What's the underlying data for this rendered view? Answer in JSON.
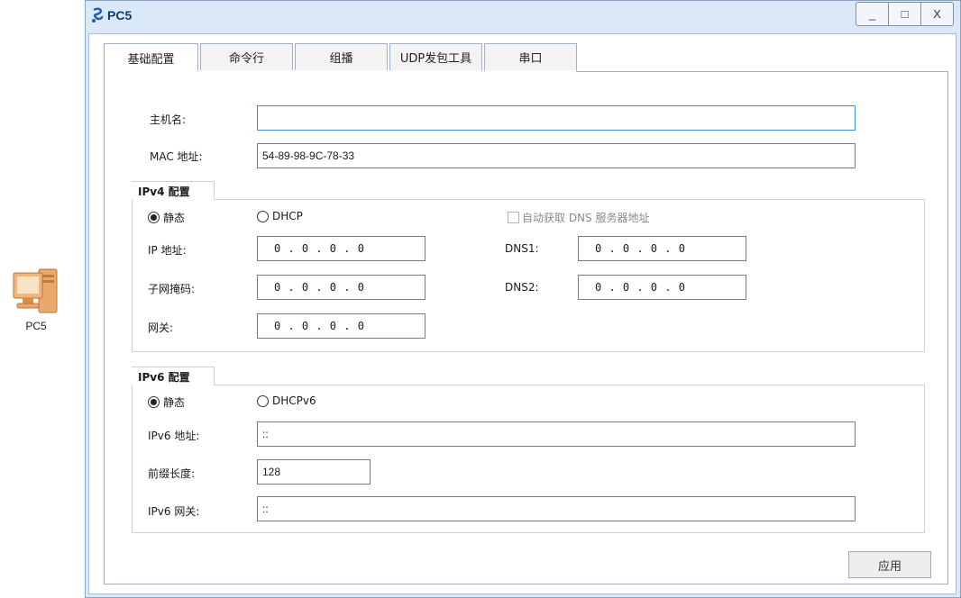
{
  "desktop": {
    "icon_label": "PC5",
    "icon_name": "pc-icon"
  },
  "window": {
    "title": "PC5",
    "title_icon": "ensp-logo-icon",
    "controls": {
      "minimize": "_",
      "maximize": "□",
      "close": "X"
    }
  },
  "tabs": [
    {
      "label": "基础配置",
      "active": true
    },
    {
      "label": "命令行",
      "active": false
    },
    {
      "label": "组播",
      "active": false
    },
    {
      "label": "UDP发包工具",
      "active": false
    },
    {
      "label": "串口",
      "active": false
    }
  ],
  "basic": {
    "hostname_label": "主机名:",
    "hostname_value": "",
    "mac_label": "MAC 地址:",
    "mac_value": "54-89-98-9C-78-33"
  },
  "ipv4": {
    "group_title": "IPv4 配置",
    "mode_static": "静态",
    "mode_dhcp": "DHCP",
    "auto_dns": "自动获取 DNS 服务器地址",
    "ip_label": "IP 地址:",
    "ip_value": "0  .  0  .  0  .  0",
    "mask_label": "子网掩码:",
    "mask_value": "0  .  0  .  0  .  0",
    "gw_label": "网关:",
    "gw_value": "0  .  0  .  0  .  0",
    "dns1_label": "DNS1:",
    "dns1_value": "0  .  0  .  0  .  0",
    "dns2_label": "DNS2:",
    "dns2_value": "0  .  0  .  0  .  0"
  },
  "ipv6": {
    "group_title": "IPv6 配置",
    "mode_static": "静态",
    "mode_dhcp": "DHCPv6",
    "addr_label": "IPv6 地址:",
    "addr_value": "::",
    "prefix_label": "前缀长度:",
    "prefix_value": "128",
    "gw_label": "IPv6 网关:",
    "gw_value": "::"
  },
  "apply_label": "应用"
}
